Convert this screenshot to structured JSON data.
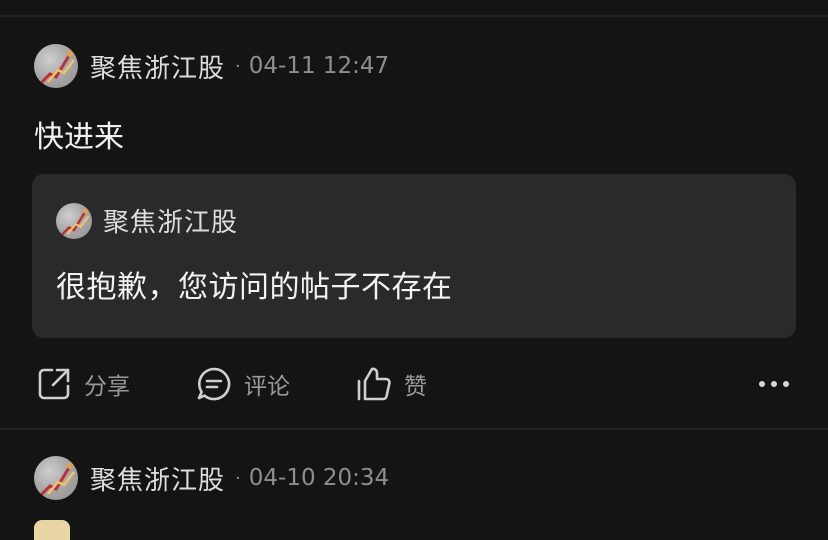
{
  "posts": [
    {
      "author": "聚焦浙江股",
      "separator": "·",
      "time": "04-11 12:47",
      "body": "快进来",
      "quote": {
        "author": "聚焦浙江股",
        "text": "很抱歉，您访问的帖子不存在"
      },
      "actions": {
        "share_label": "分享",
        "comment_label": "评论",
        "like_label": "赞"
      }
    },
    {
      "author": "聚焦浙江股",
      "separator": "·",
      "time": "04-10 20:34"
    }
  ],
  "icons": {
    "share": "share-icon",
    "comment": "comment-icon",
    "like": "thumbs-up-icon",
    "more": "more-horizontal-icon"
  },
  "colors": {
    "background": "#141414",
    "card": "#2a2a2c",
    "divider": "#242424",
    "secondary_text": "#8e8e8e"
  }
}
